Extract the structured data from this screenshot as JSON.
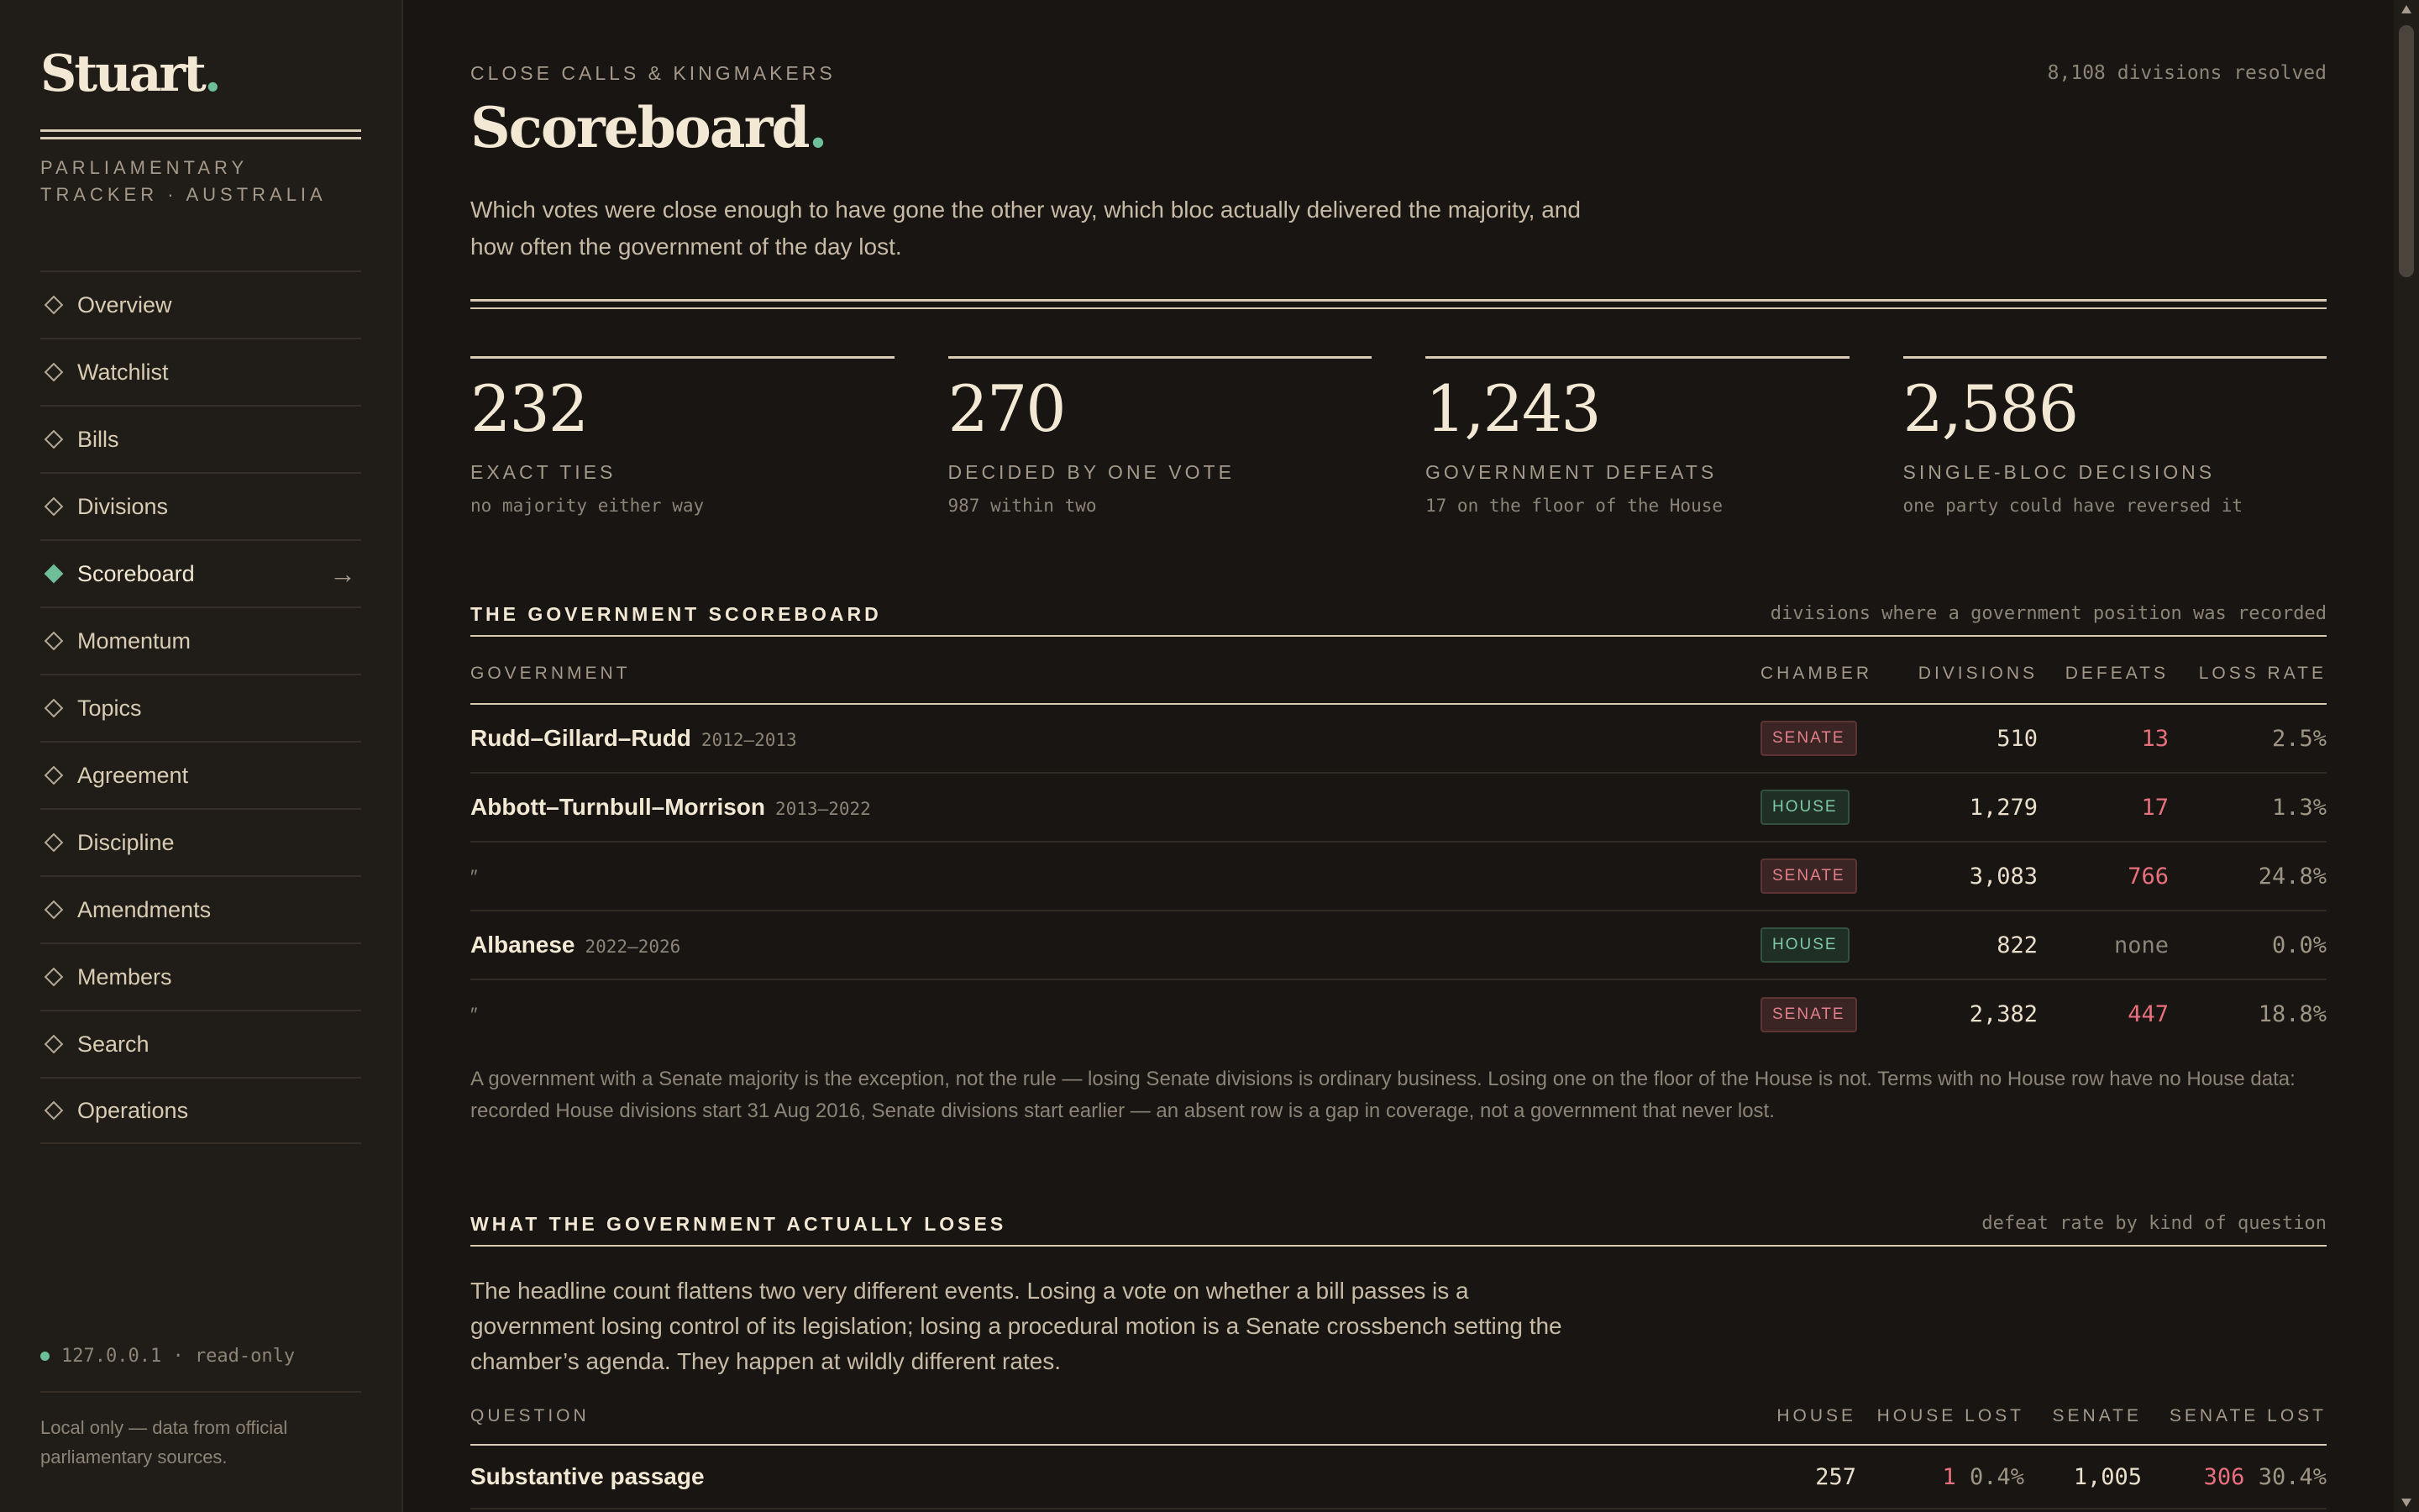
{
  "sidebar": {
    "brand": "Stuart",
    "brand_dot": ".",
    "subtitle_line1": "PARLIAMENTARY",
    "subtitle_line2": "TRACKER · AUSTRALIA",
    "items": [
      {
        "label": "Overview",
        "icon": "diamond-outline-icon"
      },
      {
        "label": "Watchlist",
        "icon": "diamond-outline-icon"
      },
      {
        "label": "Bills",
        "icon": "diamond-outline-icon"
      },
      {
        "label": "Divisions",
        "icon": "diamond-outline-icon"
      },
      {
        "label": "Scoreboard",
        "icon": "diamond-filled-icon",
        "active": true,
        "arrow": "→"
      },
      {
        "label": "Momentum",
        "icon": "diamond-outline-icon"
      },
      {
        "label": "Topics",
        "icon": "diamond-outline-icon"
      },
      {
        "label": "Agreement",
        "icon": "diamond-outline-icon"
      },
      {
        "label": "Discipline",
        "icon": "diamond-outline-icon"
      },
      {
        "label": "Amendments",
        "icon": "diamond-outline-icon"
      },
      {
        "label": "Members",
        "icon": "diamond-outline-icon"
      },
      {
        "label": "Search",
        "icon": "diamond-outline-icon"
      },
      {
        "label": "Operations",
        "icon": "diamond-outline-icon"
      }
    ],
    "status": "127.0.0.1 · read-only",
    "footer": "Local only — data from official parliamentary sources."
  },
  "header": {
    "eyebrow": "CLOSE CALLS & KINGMAKERS",
    "resolved": "8,108 divisions resolved",
    "title": "Scoreboard",
    "title_dot": ".",
    "intro": "Which votes were close enough to have gone the other way, which bloc actually delivered the majority, and how often the government of the day lost."
  },
  "stats": [
    {
      "value": "232",
      "label": "EXACT TIES",
      "note": "no majority either way"
    },
    {
      "value": "270",
      "label": "DECIDED BY ONE VOTE",
      "note": "987 within two"
    },
    {
      "value": "1,243",
      "label": "GOVERNMENT DEFEATS",
      "note": "17 on the floor of the House"
    },
    {
      "value": "2,586",
      "label": "SINGLE-BLOC DECISIONS",
      "note": "one party could have reversed it"
    }
  ],
  "scoreboard": {
    "title": "THE GOVERNMENT SCOREBOARD",
    "note": "divisions where a government position was recorded",
    "columns": [
      "GOVERNMENT",
      "CHAMBER",
      "DIVISIONS",
      "DEFEATS",
      "LOSS RATE"
    ],
    "rows": [
      {
        "government": "Rudd–Gillard–Rudd",
        "years": "2012–2013",
        "chamber": "SENATE",
        "divisions": "510",
        "defeats": "13",
        "loss_rate": "2.5%"
      },
      {
        "government": "Abbott–Turnbull–Morrison",
        "years": "2013–2022",
        "chamber": "HOUSE",
        "divisions": "1,279",
        "defeats": "17",
        "loss_rate": "1.3%"
      },
      {
        "government": "″",
        "years": "",
        "chamber": "SENATE",
        "divisions": "3,083",
        "defeats": "766",
        "loss_rate": "24.8%"
      },
      {
        "government": "Albanese",
        "years": "2022–2026",
        "chamber": "HOUSE",
        "divisions": "822",
        "defeats": "none",
        "loss_rate": "0.0%"
      },
      {
        "government": "″",
        "years": "",
        "chamber": "SENATE",
        "divisions": "2,382",
        "defeats": "447",
        "loss_rate": "18.8%"
      }
    ],
    "footnote": "A government with a Senate majority is the exception, not the rule — losing Senate divisions is ordinary business. Losing one on the floor of the House is not. Terms with no House row have no House data: recorded House divisions start 31 Aug 2016, Senate divisions start earlier — an absent row is a gap in coverage, not a government that never lost."
  },
  "losses": {
    "title": "WHAT THE GOVERNMENT ACTUALLY LOSES",
    "note": "defeat rate by kind of question",
    "body": "The headline count flattens two very different events. Losing a vote on whether a bill passes is a government losing control of its legislation; losing a procedural motion is a Senate crossbench setting the chamber’s agenda. They happen at wildly different rates.",
    "columns": [
      "QUESTION",
      "HOUSE",
      "HOUSE LOST",
      "SENATE",
      "SENATE LOST"
    ],
    "rows": [
      {
        "question": "Substantive passage",
        "house": "257",
        "house_lost": "1",
        "house_lost_pct": "0.4%",
        "senate": "1,005",
        "senate_lost": "306",
        "senate_lost_pct": "30.4%"
      }
    ]
  },
  "colors": {
    "accent": "#6fbe9a",
    "defeat": "#e8707d",
    "background": "#181512",
    "sidebar": "#201c17"
  }
}
